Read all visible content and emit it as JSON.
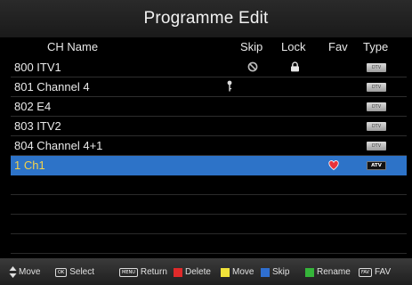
{
  "title": "Programme Edit",
  "columns": {
    "name": "CH Name",
    "skip": "Skip",
    "lock": "Lock",
    "fav": "Fav",
    "type": "Type"
  },
  "channels": [
    {
      "name": "800 ITV1",
      "type": "DTV",
      "skip": true,
      "lock": true,
      "key": false,
      "fav": false
    },
    {
      "name": "801 Channel 4",
      "type": "DTV",
      "skip": false,
      "lock": false,
      "key": true,
      "fav": false
    },
    {
      "name": "802 E4",
      "type": "DTV",
      "skip": false,
      "lock": false,
      "key": false,
      "fav": false
    },
    {
      "name": "803 ITV2",
      "type": "DTV",
      "skip": false,
      "lock": false,
      "key": false,
      "fav": false
    },
    {
      "name": "804 Channel 4+1",
      "type": "DTV",
      "skip": false,
      "lock": false,
      "key": false,
      "fav": false
    },
    {
      "name": "1 Ch1",
      "type": "ATV",
      "skip": false,
      "lock": false,
      "key": false,
      "fav": true,
      "selected": true
    }
  ],
  "footer": {
    "move": "Move",
    "ok_key": "OK",
    "select": "Select",
    "menu_key": "MENU",
    "return": "Return",
    "delete": "Delete",
    "move_yellow": "Move",
    "skip": "Skip",
    "rename": "Rename",
    "fav_key": "FAV",
    "fav": "FAV"
  },
  "colors": {
    "selected_row": "#2d73c8",
    "selected_text": "#f5d34b",
    "red": "#e02a2a",
    "yellow": "#f0e23a",
    "blue": "#2f6fd0",
    "green": "#35b53a"
  }
}
